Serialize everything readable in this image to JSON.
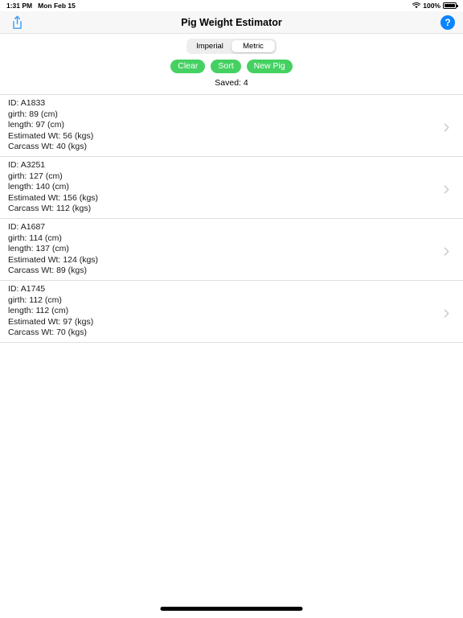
{
  "status_bar": {
    "time": "1:31 PM",
    "date": "Mon Feb 15",
    "battery_percent": "100%",
    "wifi_icon": "wifi-icon",
    "battery_icon": "battery-icon"
  },
  "nav_bar": {
    "title": "Pig Weight Estimator",
    "share_icon": "share-icon",
    "help_label": "?",
    "help_icon": "help-circle-icon",
    "accent_color": "#0a84ff",
    "background_color": "#f7f7f7"
  },
  "controls": {
    "units": {
      "options": [
        "Imperial",
        "Metric"
      ],
      "selected": "Metric"
    },
    "buttons": [
      {
        "label": "Clear",
        "name": "clear-button"
      },
      {
        "label": "Sort",
        "name": "sort-button"
      },
      {
        "label": "New Pig",
        "name": "new-pig-button"
      }
    ],
    "button_color": "#45d162",
    "saved_label": "Saved: 4"
  },
  "list": {
    "rows": [
      {
        "id_line": "ID: A1833",
        "girth_line": "girth: 89 (cm)",
        "length_line": "length: 97 (cm)",
        "estimated_line": "Estimated Wt: 56 (kgs)",
        "carcass_line": "Carcass Wt: 40 (kgs)"
      },
      {
        "id_line": "ID: A3251",
        "girth_line": "girth: 127 (cm)",
        "length_line": "length: 140 (cm)",
        "estimated_line": "Estimated Wt: 156 (kgs)",
        "carcass_line": "Carcass Wt: 112 (kgs)"
      },
      {
        "id_line": "ID: A1687",
        "girth_line": "girth: 114 (cm)",
        "length_line": "length: 137 (cm)",
        "estimated_line": "Estimated Wt: 124 (kgs)",
        "carcass_line": "Carcass Wt: 89 (kgs)"
      },
      {
        "id_line": "ID: A1745",
        "girth_line": "girth: 112 (cm)",
        "length_line": "length: 112 (cm)",
        "estimated_line": "Estimated Wt: 97 (kgs)",
        "carcass_line": "Carcass Wt: 70 (kgs)"
      }
    ],
    "disclosure_icon": "chevron-right-icon"
  },
  "home_indicator": "home-indicator"
}
